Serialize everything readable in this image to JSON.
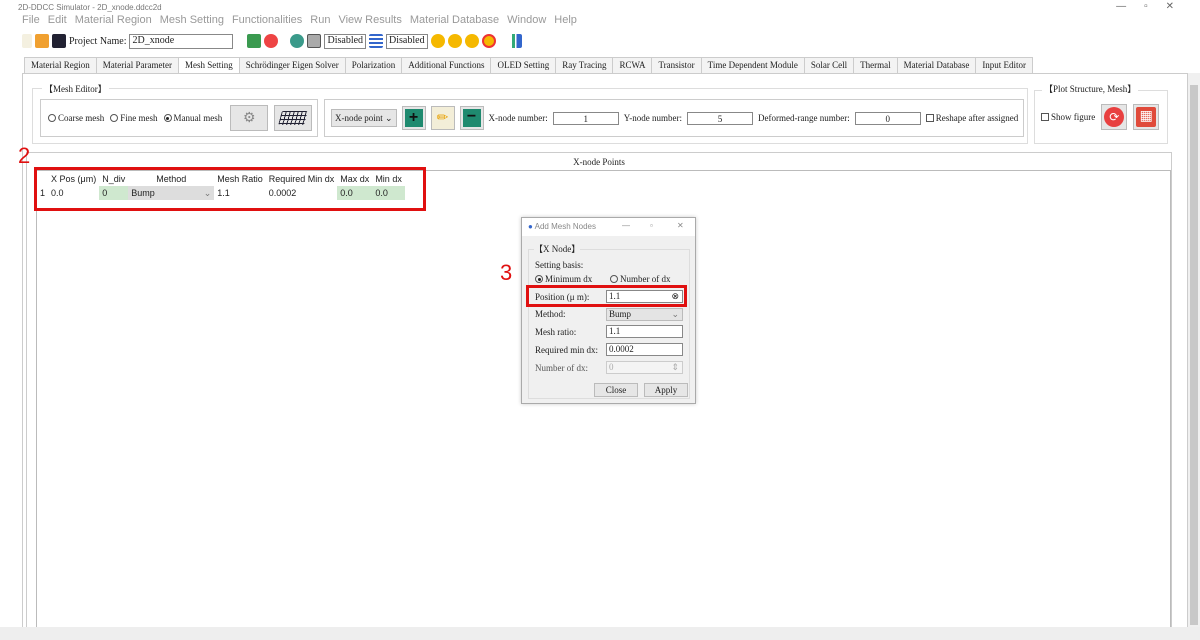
{
  "window": {
    "title": "2D-DDCC Simulator - 2D_xnode.ddcc2d"
  },
  "menu": [
    "File",
    "Edit",
    "Material Region",
    "Mesh Setting",
    "Functionalities",
    "Run",
    "View Results",
    "Material Database",
    "Window",
    "Help"
  ],
  "toolbar": {
    "project_label": "Project Name:",
    "project_name": "2D_xnode",
    "disabled1": "Disabled",
    "disabled2": "Disabled"
  },
  "tabs": [
    "Material Region",
    "Material Parameter",
    "Mesh Setting",
    "Schrödinger Eigen Solver",
    "Polarization",
    "Additional Functions",
    "OLED Setting",
    "Ray Tracing",
    "RCWA",
    "Transistor",
    "Time Dependent Module",
    "Solar Cell",
    "Thermal",
    "Material Database",
    "Input Editor"
  ],
  "active_tab": "Mesh Setting",
  "mesh_editor": {
    "title": "【Mesh Editor】",
    "coarse": "Coarse mesh",
    "fine": "Fine mesh",
    "manual": "Manual mesh",
    "selected": "Manual mesh",
    "node_select": "X-node point",
    "x_node_label": "X-node number:",
    "x_node": "1",
    "y_node_label": "Y-node number:",
    "y_node": "5",
    "deformed_label": "Deformed-range number:",
    "deformed": "0",
    "reshape": "Reshape after assigned"
  },
  "plot": {
    "title": "【Plot Structure, Mesh】",
    "show_figure": "Show figure"
  },
  "xpoints": {
    "title": "X-node Points",
    "columns": [
      "X Pos (μm)",
      "N_div",
      "Method",
      "Mesh Ratio",
      "Required Min dx",
      "Max dx",
      "Min dx"
    ],
    "rows": [
      {
        "index": "1",
        "cells": [
          "0.0",
          "0",
          "Bump",
          "1.1",
          "0.0002",
          "0.0",
          "0.0"
        ]
      }
    ]
  },
  "annotations": {
    "a2": "2",
    "a3": "3",
    "color": "#e01010"
  },
  "dialog": {
    "title": "Add Mesh Nodes",
    "group": "【X Node】",
    "basis_label": "Setting basis:",
    "min_dx": "Minimum dx",
    "num_dx": "Number of dx",
    "basis_selected": "Minimum dx",
    "position_label": "Position (μ m):",
    "position": "1.1",
    "method_label": "Method:",
    "method": "Bump",
    "ratio_label": "Mesh ratio:",
    "ratio": "1.1",
    "reqmin_label": "Required min dx:",
    "reqmin": "0.0002",
    "numdx_label": "Number of dx:",
    "numdx": "0",
    "close": "Close",
    "apply": "Apply"
  }
}
